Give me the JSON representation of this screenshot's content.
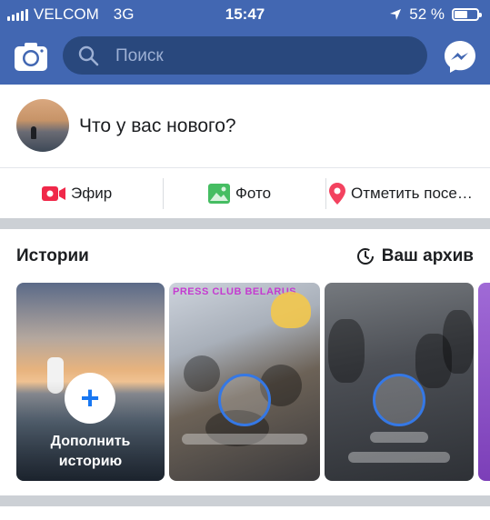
{
  "status_bar": {
    "carrier": "VELCOM",
    "network": "3G",
    "time": "15:47",
    "battery": "52 %",
    "battery_level": 0.52
  },
  "nav": {
    "search_placeholder": "Поиск",
    "camera_icon": "camera-icon",
    "messenger_icon": "messenger-icon"
  },
  "composer": {
    "prompt": "Что у вас нового?"
  },
  "actions": {
    "live": "Эфир",
    "photo": "Фото",
    "checkin": "Отметить посе…"
  },
  "stories": {
    "title": "Истории",
    "archive": "Ваш архив",
    "add_line1": "Дополнить",
    "add_line2": "историю",
    "story2_banner": "PRESS CLUB BELARUS"
  },
  "colors": {
    "brand": "#4267b2",
    "search_bg": "#29487d",
    "live_red": "#f02849",
    "photo_green": "#45bd62",
    "checkin_pink": "#f3425f",
    "story_ring": "#3578e5"
  }
}
